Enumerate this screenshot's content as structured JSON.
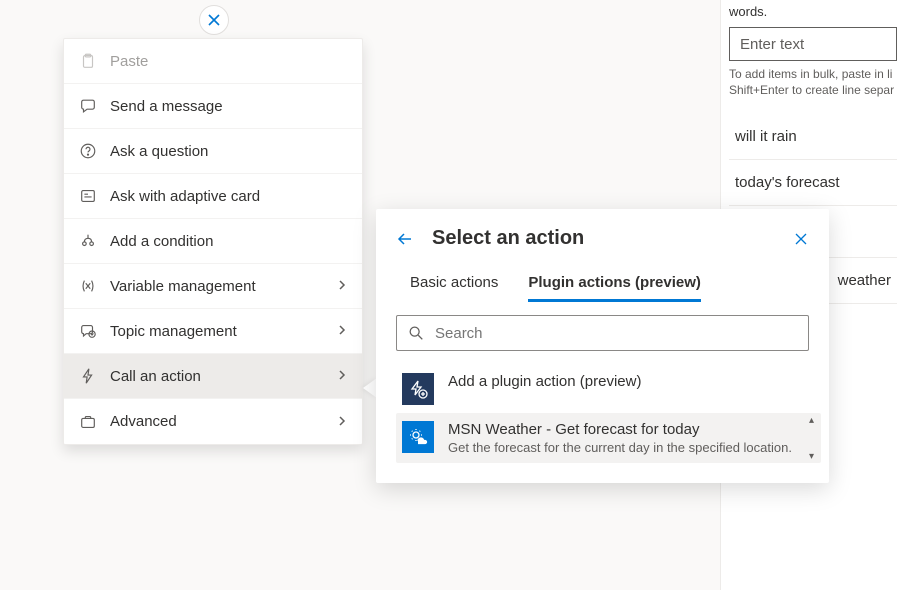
{
  "closeNode": {
    "icon": "close-icon"
  },
  "menu": {
    "items": [
      {
        "icon": "paste-icon",
        "label": "Paste",
        "disabled": true,
        "hasSub": false
      },
      {
        "icon": "message-icon",
        "label": "Send a message",
        "hasSub": false
      },
      {
        "icon": "question-icon",
        "label": "Ask a question",
        "hasSub": false
      },
      {
        "icon": "card-icon",
        "label": "Ask with adaptive card",
        "hasSub": false
      },
      {
        "icon": "branch-icon",
        "label": "Add a condition",
        "hasSub": false
      },
      {
        "icon": "variable-icon",
        "label": "Variable management",
        "hasSub": true
      },
      {
        "icon": "topic-icon",
        "label": "Topic management",
        "hasSub": true
      },
      {
        "icon": "action-icon",
        "label": "Call an action",
        "hasSub": true,
        "active": true
      },
      {
        "icon": "advanced-icon",
        "label": "Advanced",
        "hasSub": true
      }
    ]
  },
  "flyout": {
    "title": "Select an action",
    "tabs": {
      "basic": "Basic actions",
      "plugin": "Plugin actions (preview)"
    },
    "search": {
      "placeholder": "Search"
    },
    "actions": {
      "addPlugin": {
        "title": "Add a plugin action (preview)"
      },
      "msn": {
        "title": "MSN Weather - Get forecast for today",
        "desc": "Get the forecast for the current day in the specified location."
      }
    }
  },
  "panel": {
    "hint_tail": "words.",
    "input_placeholder": "Enter text",
    "bulkHint1": "To add items in bulk, paste in li",
    "bulkHint2": "Shift+Enter to create line separ",
    "phrases": [
      "will it rain",
      "today's forecast",
      "weather"
    ]
  }
}
